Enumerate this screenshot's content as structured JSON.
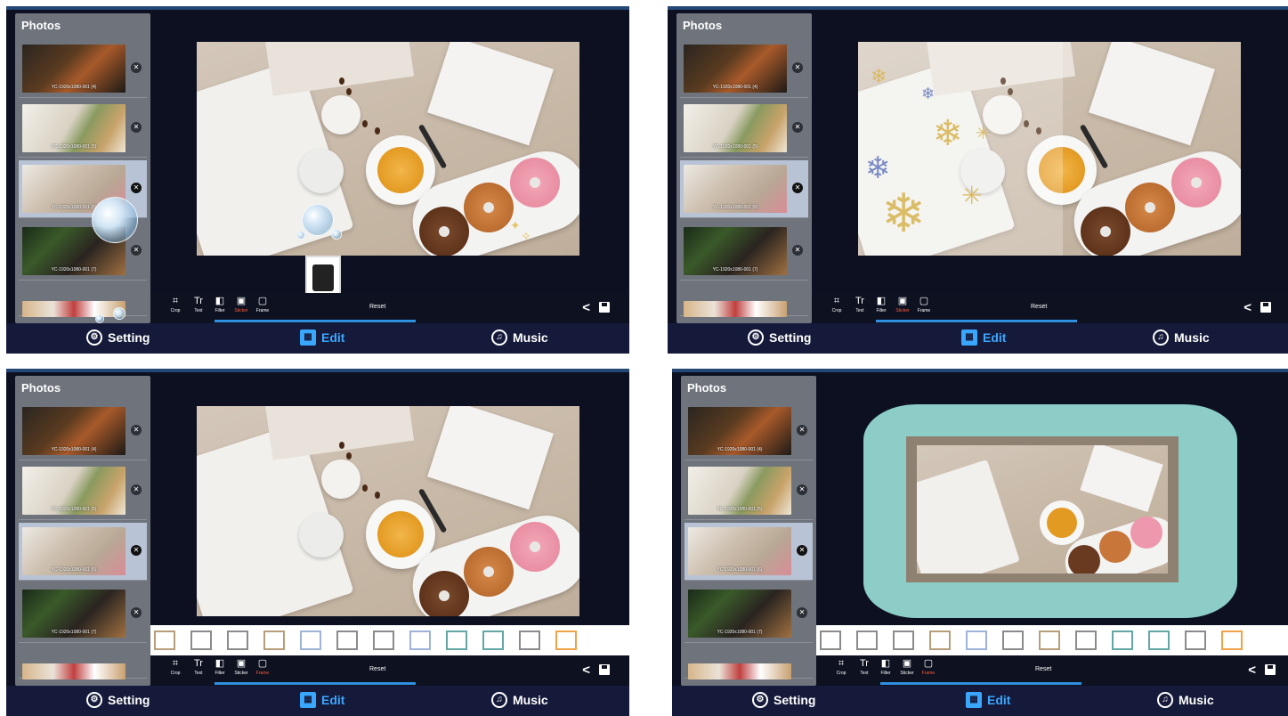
{
  "sidebar": {
    "title": "Photos",
    "captions_p0": [
      "YC-1920x1080-001 (4)",
      "YC-1920x1080-001 (5)",
      "YC-1920x1080-001 (6)",
      "YC-1920x1080-001 (7)"
    ],
    "captions_p1": [
      "YC-1920x1080-001 (4)",
      "YC-1920x1080-001 (5)",
      "YC-1920x1080-001 (6)",
      "YC-1920x1080-001 (7)"
    ],
    "captions_p2": [
      "YC-1920x1080-001 (4)",
      "YC-1920x1080-001 (5)",
      "YC-1920x1080-001 (6)",
      "YC-1920x1080-001 (7)"
    ],
    "captions_p3": [
      "YC-1920x1080-001 (4)",
      "YC-1920x1080-001 (5)",
      "YC-1920x1080-001 (6)",
      "YC-1920x1080-001 (7)"
    ],
    "remove_glyph": "✕"
  },
  "toolbar": {
    "tools": [
      {
        "label": "Crop",
        "glyph": "⌗"
      },
      {
        "label": "Text",
        "glyph": "Tr"
      },
      {
        "label": "Filter",
        "glyph": "◧"
      },
      {
        "label": "Sticker",
        "glyph": "▣"
      },
      {
        "label": "Frame",
        "glyph": "▢"
      }
    ],
    "reset": "Reset",
    "share_glyph": "<",
    "active_p0": "Sticker",
    "active_p1": "Sticker",
    "active_p2": "Frame",
    "active_p3": "Frame"
  },
  "nav": {
    "setting": "Setting",
    "edit": "Edit",
    "music": "Music",
    "setting_glyph": "⚙",
    "edit_glyph": "▦",
    "music_glyph": "♫"
  },
  "colors": {
    "accent": "#3aa7ff",
    "active_tool": "#ff5a3a",
    "frame_teal": "#8ccdc7"
  }
}
